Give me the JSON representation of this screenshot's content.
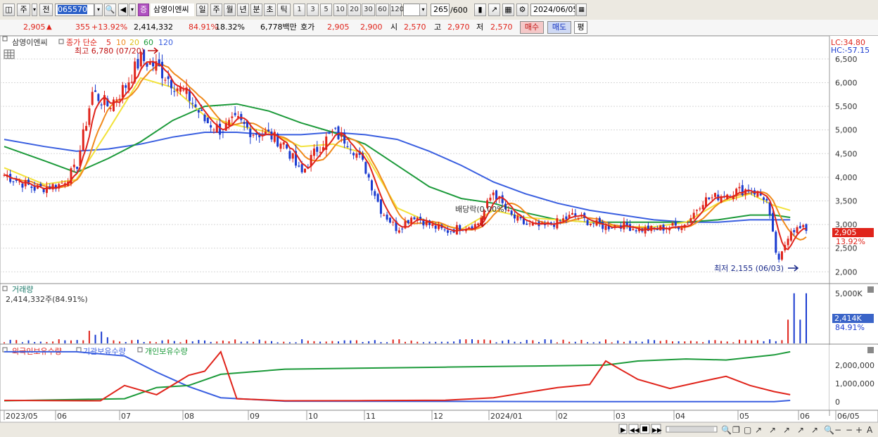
{
  "toolbar": {
    "type_label": "주",
    "prev_label": "전",
    "code": "065570",
    "stock_badge": "증",
    "stock_name": "삼영이엔씨",
    "periods": [
      "일",
      "주",
      "월",
      "년",
      "분",
      "초",
      "틱"
    ],
    "active_period": "일",
    "intervals": [
      "1",
      "3",
      "5",
      "10",
      "20",
      "30",
      "60",
      "120"
    ],
    "count": "265",
    "max_count": "/600",
    "date": "2024/06/05"
  },
  "quote": {
    "price": "2,905",
    "change": "355",
    "change_rate": "+13.92%",
    "volume": "2,414,332",
    "volume_rate": "84.91%",
    "turnover": "18.32%",
    "amount": "6,778백만",
    "hoga_label": "호가",
    "ask": "2,905",
    "bid": "2,900",
    "open_label": "시",
    "open": "2,570",
    "high_label": "고",
    "high": "2,970",
    "low_label": "저",
    "low": "2,570",
    "buy_label": "매수",
    "sell_label": "매도",
    "avg_label": "평"
  },
  "colors": {
    "up": "#e0241b",
    "down": "#1a3bd0",
    "ma5": "#e0241b",
    "ma10": "#f08a1c",
    "ma20": "#f2e23a",
    "ma60": "#1c9a3a",
    "ma120": "#3a5fe0",
    "foreign": "#e0241b",
    "inst": "#3a5fe0",
    "indiv": "#1c9a3a"
  },
  "price_panel": {
    "name": "삼영이엔씨",
    "legend_prefix": "종가 단순",
    "ma_labels": [
      "5",
      "10",
      "20",
      "60",
      "120"
    ],
    "max_label": "최고 6,780 (07/20)",
    "min_label": "최저 2,155 (06/03)",
    "dividend_label": "배당락(0.00%)",
    "lc_label": "LC:34.80",
    "hc_label": "HC:-57.15",
    "last_price": "2,905",
    "last_rate": "13.92%"
  },
  "volume_panel": {
    "title": "거래량",
    "value": "2,414,332주(84.91%)",
    "last": "2,414K",
    "last_rate": "84.91%"
  },
  "holding_panel": {
    "foreign": "외국인보유수량",
    "inst": "기관보유수량",
    "indiv": "개인보유수량"
  },
  "bottom": {
    "zoom_minus": "−",
    "zoom_plus": "+",
    "auto": "A"
  },
  "chart_data": {
    "type": "candlestick",
    "x_ticks": [
      "2023/05",
      "06",
      "07",
      "08",
      "09",
      "10",
      "11",
      "12",
      "2024/01",
      "02",
      "03",
      "04",
      "05",
      "06",
      "06/05"
    ],
    "price_ticks": [
      "6,500",
      "6,000",
      "5,500",
      "5,000",
      "4,500",
      "4,000",
      "3,500",
      "3,000",
      "2,500",
      "2,000"
    ],
    "ylim": [
      1900,
      6900
    ],
    "price_series": [
      {
        "t": 0,
        "p": 4050
      },
      {
        "t": 0.04,
        "p": 3750
      },
      {
        "t": 0.07,
        "p": 3850
      },
      {
        "t": 0.09,
        "p": 4200
      },
      {
        "t": 0.11,
        "p": 5800
      },
      {
        "t": 0.13,
        "p": 5500
      },
      {
        "t": 0.15,
        "p": 5900
      },
      {
        "t": 0.17,
        "p": 6500
      },
      {
        "t": 0.19,
        "p": 6350
      },
      {
        "t": 0.21,
        "p": 6000
      },
      {
        "t": 0.23,
        "p": 5700
      },
      {
        "t": 0.25,
        "p": 5200
      },
      {
        "t": 0.27,
        "p": 5000
      },
      {
        "t": 0.29,
        "p": 5200
      },
      {
        "t": 0.31,
        "p": 4950
      },
      {
        "t": 0.33,
        "p": 4900
      },
      {
        "t": 0.35,
        "p": 4700
      },
      {
        "t": 0.37,
        "p": 4050
      },
      {
        "t": 0.39,
        "p": 4600
      },
      {
        "t": 0.41,
        "p": 4950
      },
      {
        "t": 0.43,
        "p": 4750
      },
      {
        "t": 0.45,
        "p": 4200
      },
      {
        "t": 0.47,
        "p": 3300
      },
      {
        "t": 0.49,
        "p": 2900
      },
      {
        "t": 0.51,
        "p": 3200
      },
      {
        "t": 0.53,
        "p": 3000
      },
      {
        "t": 0.55,
        "p": 2850
      },
      {
        "t": 0.57,
        "p": 2950
      },
      {
        "t": 0.59,
        "p": 3000
      },
      {
        "t": 0.61,
        "p": 3700
      },
      {
        "t": 0.63,
        "p": 3200
      },
      {
        "t": 0.65,
        "p": 3000
      },
      {
        "t": 0.67,
        "p": 2950
      },
      {
        "t": 0.69,
        "p": 3050
      },
      {
        "t": 0.71,
        "p": 3200
      },
      {
        "t": 0.73,
        "p": 3050
      },
      {
        "t": 0.75,
        "p": 2950
      },
      {
        "t": 0.77,
        "p": 3000
      },
      {
        "t": 0.79,
        "p": 2900
      },
      {
        "t": 0.81,
        "p": 2900
      },
      {
        "t": 0.83,
        "p": 2950
      },
      {
        "t": 0.85,
        "p": 3000
      },
      {
        "t": 0.87,
        "p": 3500
      },
      {
        "t": 0.89,
        "p": 3600
      },
      {
        "t": 0.91,
        "p": 3700
      },
      {
        "t": 0.93,
        "p": 3750
      },
      {
        "t": 0.95,
        "p": 3550
      },
      {
        "t": 0.965,
        "p": 2155
      },
      {
        "t": 0.98,
        "p": 2905
      }
    ],
    "ma_series": {
      "ma20": [
        [
          0,
          4200
        ],
        [
          0.05,
          3850
        ],
        [
          0.09,
          3950
        ],
        [
          0.13,
          5000
        ],
        [
          0.17,
          6100
        ],
        [
          0.21,
          5900
        ],
        [
          0.25,
          5300
        ],
        [
          0.29,
          5100
        ],
        [
          0.33,
          4950
        ],
        [
          0.37,
          4650
        ],
        [
          0.41,
          4700
        ],
        [
          0.45,
          4500
        ],
        [
          0.49,
          3350
        ],
        [
          0.53,
          3050
        ],
        [
          0.57,
          2900
        ],
        [
          0.61,
          3300
        ],
        [
          0.65,
          3150
        ],
        [
          0.69,
          3100
        ],
        [
          0.73,
          3050
        ],
        [
          0.77,
          2950
        ],
        [
          0.81,
          2950
        ],
        [
          0.85,
          3050
        ],
        [
          0.89,
          3450
        ],
        [
          0.93,
          3650
        ],
        [
          0.96,
          3400
        ],
        [
          0.98,
          3300
        ]
      ],
      "ma60": [
        [
          0,
          4650
        ],
        [
          0.05,
          4350
        ],
        [
          0.09,
          4100
        ],
        [
          0.13,
          4400
        ],
        [
          0.17,
          4750
        ],
        [
          0.21,
          5200
        ],
        [
          0.25,
          5500
        ],
        [
          0.29,
          5550
        ],
        [
          0.33,
          5400
        ],
        [
          0.37,
          5150
        ],
        [
          0.41,
          4950
        ],
        [
          0.45,
          4700
        ],
        [
          0.49,
          4250
        ],
        [
          0.53,
          3800
        ],
        [
          0.57,
          3550
        ],
        [
          0.61,
          3450
        ],
        [
          0.65,
          3250
        ],
        [
          0.69,
          3100
        ],
        [
          0.73,
          3050
        ],
        [
          0.77,
          3050
        ],
        [
          0.81,
          3050
        ],
        [
          0.85,
          3050
        ],
        [
          0.89,
          3100
        ],
        [
          0.93,
          3200
        ],
        [
          0.96,
          3200
        ],
        [
          0.98,
          3150
        ]
      ],
      "ma120": [
        [
          0,
          4800
        ],
        [
          0.05,
          4650
        ],
        [
          0.09,
          4550
        ],
        [
          0.13,
          4600
        ],
        [
          0.17,
          4700
        ],
        [
          0.21,
          4850
        ],
        [
          0.25,
          4950
        ],
        [
          0.29,
          4950
        ],
        [
          0.33,
          4900
        ],
        [
          0.37,
          4900
        ],
        [
          0.41,
          4950
        ],
        [
          0.45,
          4900
        ],
        [
          0.49,
          4800
        ],
        [
          0.53,
          4550
        ],
        [
          0.57,
          4250
        ],
        [
          0.61,
          3900
        ],
        [
          0.65,
          3650
        ],
        [
          0.69,
          3450
        ],
        [
          0.73,
          3300
        ],
        [
          0.77,
          3200
        ],
        [
          0.81,
          3100
        ],
        [
          0.85,
          3050
        ],
        [
          0.89,
          3050
        ],
        [
          0.93,
          3100
        ],
        [
          0.96,
          3100
        ],
        [
          0.98,
          3100
        ]
      ]
    },
    "volume_ticks": [
      "5,000K",
      "2,414K"
    ],
    "holding_ticks": [
      "2,000,000",
      "1,000,000",
      "0"
    ],
    "holding_series": {
      "foreign": [
        [
          0,
          70000
        ],
        [
          0.12,
          50000
        ],
        [
          0.15,
          800000
        ],
        [
          0.19,
          350000
        ],
        [
          0.23,
          1300000
        ],
        [
          0.25,
          1500000
        ],
        [
          0.27,
          2450000
        ],
        [
          0.29,
          150000
        ],
        [
          0.35,
          50000
        ],
        [
          0.45,
          60000
        ],
        [
          0.55,
          80000
        ],
        [
          0.61,
          200000
        ],
        [
          0.69,
          700000
        ],
        [
          0.73,
          850000
        ],
        [
          0.75,
          2000000
        ],
        [
          0.79,
          1100000
        ],
        [
          0.83,
          650000
        ],
        [
          0.87,
          1000000
        ],
        [
          0.9,
          1250000
        ],
        [
          0.93,
          800000
        ],
        [
          0.96,
          500000
        ],
        [
          0.98,
          350000
        ]
      ],
      "inst": [
        [
          0,
          2450000
        ],
        [
          0.09,
          2450000
        ],
        [
          0.15,
          2250000
        ],
        [
          0.19,
          1450000
        ],
        [
          0.23,
          750000
        ],
        [
          0.27,
          200000
        ],
        [
          0.35,
          30000
        ],
        [
          0.55,
          20000
        ],
        [
          0.75,
          10000
        ],
        [
          0.96,
          10000
        ],
        [
          0.98,
          70000
        ]
      ],
      "indiv": [
        [
          0,
          50000
        ],
        [
          0.15,
          150000
        ],
        [
          0.19,
          700000
        ],
        [
          0.23,
          800000
        ],
        [
          0.27,
          1350000
        ],
        [
          0.35,
          1600000
        ],
        [
          0.45,
          1650000
        ],
        [
          0.55,
          1700000
        ],
        [
          0.65,
          1750000
        ],
        [
          0.75,
          1800000
        ],
        [
          0.79,
          2000000
        ],
        [
          0.85,
          2100000
        ],
        [
          0.9,
          2050000
        ],
        [
          0.96,
          2300000
        ],
        [
          0.98,
          2450000
        ]
      ]
    }
  }
}
